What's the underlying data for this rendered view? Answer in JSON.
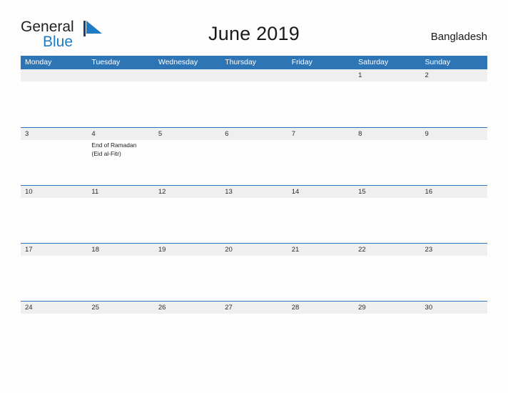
{
  "brand": {
    "word_general": "General",
    "word_blue": "Blue",
    "flag_icon": "blue-triangle-flag-icon",
    "flag_color": "#1f7ac4"
  },
  "header": {
    "title": "June 2019",
    "country": "Bangladesh"
  },
  "theme": {
    "header_blue": "#2e75b6",
    "date_band_gray": "#efefef",
    "page_background": "#fdfdfd",
    "brand_blue": "#1f7ac4",
    "text_color": "#1a1a1a"
  },
  "calendar": {
    "month": "June",
    "year": "2019",
    "weekdays": [
      "Monday",
      "Tuesday",
      "Wednesday",
      "Thursday",
      "Friday",
      "Saturday",
      "Sunday"
    ],
    "weeks": [
      [
        {
          "day": "",
          "events": []
        },
        {
          "day": "",
          "events": []
        },
        {
          "day": "",
          "events": []
        },
        {
          "day": "",
          "events": []
        },
        {
          "day": "",
          "events": []
        },
        {
          "day": "1",
          "events": []
        },
        {
          "day": "2",
          "events": []
        }
      ],
      [
        {
          "day": "3",
          "events": []
        },
        {
          "day": "4",
          "events": [
            "End of Ramadan",
            "(Eid al-Fitr)"
          ]
        },
        {
          "day": "5",
          "events": []
        },
        {
          "day": "6",
          "events": []
        },
        {
          "day": "7",
          "events": []
        },
        {
          "day": "8",
          "events": []
        },
        {
          "day": "9",
          "events": []
        }
      ],
      [
        {
          "day": "10",
          "events": []
        },
        {
          "day": "11",
          "events": []
        },
        {
          "day": "12",
          "events": []
        },
        {
          "day": "13",
          "events": []
        },
        {
          "day": "14",
          "events": []
        },
        {
          "day": "15",
          "events": []
        },
        {
          "day": "16",
          "events": []
        }
      ],
      [
        {
          "day": "17",
          "events": []
        },
        {
          "day": "18",
          "events": []
        },
        {
          "day": "19",
          "events": []
        },
        {
          "day": "20",
          "events": []
        },
        {
          "day": "21",
          "events": []
        },
        {
          "day": "22",
          "events": []
        },
        {
          "day": "23",
          "events": []
        }
      ],
      [
        {
          "day": "24",
          "events": []
        },
        {
          "day": "25",
          "events": []
        },
        {
          "day": "26",
          "events": []
        },
        {
          "day": "27",
          "events": []
        },
        {
          "day": "28",
          "events": []
        },
        {
          "day": "29",
          "events": []
        },
        {
          "day": "30",
          "events": []
        }
      ]
    ]
  }
}
